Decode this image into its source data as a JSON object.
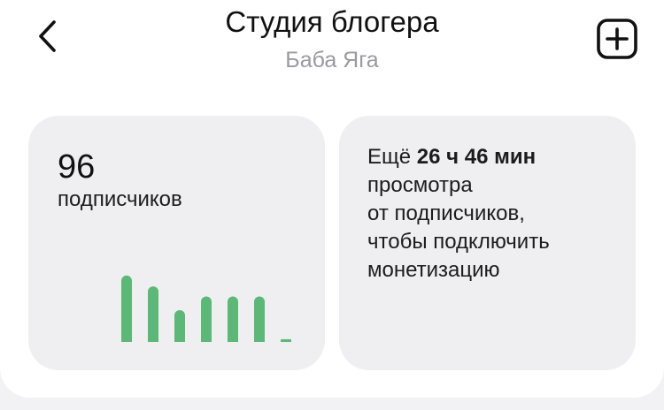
{
  "header": {
    "title": "Студия блогера",
    "subtitle": "Баба Яга",
    "back_icon": "chevron-left-icon",
    "add_icon": "plus-square-icon"
  },
  "subscribers": {
    "count": "96",
    "label": "подписчиков",
    "accent": "#5cb877"
  },
  "chart_data": {
    "type": "bar",
    "categories": [
      "",
      "",
      "",
      "",
      "",
      "",
      ""
    ],
    "values": [
      73,
      61,
      35,
      50,
      50,
      50,
      3
    ],
    "title": "",
    "xlabel": "",
    "ylabel": "",
    "ylim": [
      0,
      100
    ],
    "grid": false,
    "color": "#5cb877"
  },
  "monetization": {
    "prefix": "Ещё ",
    "amount": "26 ч 46 мин",
    "line2": "просмотра",
    "line3": "от подписчиков,",
    "line4": "чтобы подключить",
    "line5": "монетизацию"
  }
}
